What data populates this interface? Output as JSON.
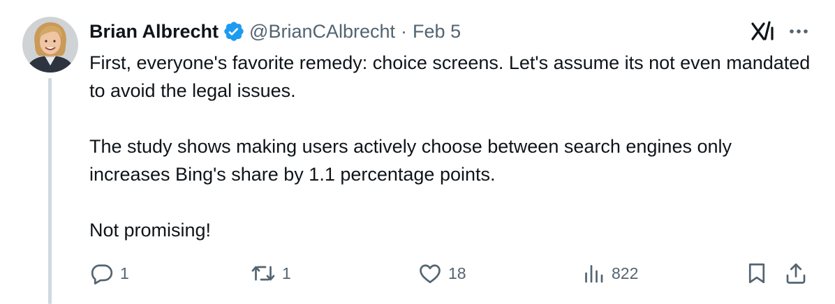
{
  "author": {
    "name": "Brian Albrecht",
    "handle": "@BrianCAlbrecht",
    "separator": "·",
    "date": "Feb 5",
    "verified_icon": "verified-badge-icon"
  },
  "tweet": {
    "paragraphs": [
      "First, everyone's favorite remedy: choice screens. Let's assume its not even mandated to avoid the legal issues.",
      "The study shows making users actively choose between search engines only increases Bing's share by 1.1 percentage points.",
      "Not promising!"
    ]
  },
  "actions": {
    "reply_count": "1",
    "repost_count": "1",
    "like_count": "18",
    "views_count": "822"
  },
  "colors": {
    "text": "#0f1419",
    "secondary": "#536471",
    "verified": "#1d9bf0",
    "thread_line": "#cfd9de"
  }
}
